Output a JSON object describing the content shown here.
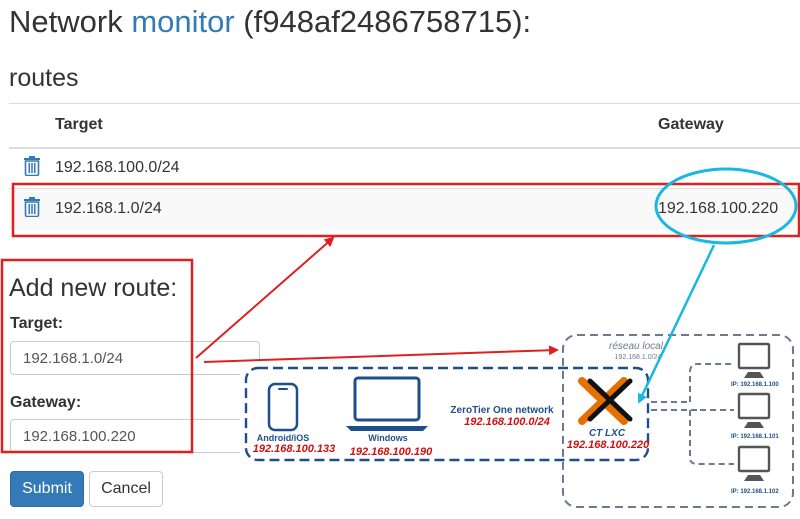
{
  "page": {
    "title_prefix": "Network ",
    "title_link": "monitor",
    "title_suffix": " (f948af2486758715):",
    "section": "routes"
  },
  "routes_table": {
    "headers": [
      "Target",
      "Gateway"
    ],
    "rows": [
      {
        "target": "192.168.100.0/24",
        "gateway": ""
      },
      {
        "target": "192.168.1.0/24",
        "gateway": "192.168.100.220"
      }
    ]
  },
  "form": {
    "heading": "Add new route:",
    "target_label": "Target:",
    "target_value": "192.168.1.0/24",
    "gateway_label": "Gateway:",
    "gateway_value": "192.168.100.220",
    "submit_label": "Submit",
    "cancel_label": "Cancel"
  },
  "diagram": {
    "android_label": "Android/iOS",
    "android_ip": "192.168.100.133",
    "windows_label": "Windows",
    "windows_ip": "192.168.100.190",
    "zerotier_label": "ZeroTier One network",
    "zerotier_net": "192.168.100.0/24",
    "ct_label": "CT  LXC",
    "ct_ip": "192.168.100.220",
    "local_label": "réseau local",
    "local_net": "192.168.1.0/24",
    "host_ips": [
      "IP: 192.168.1.100",
      "IP: 192.168.1.101",
      "IP: 192.168.1.102"
    ]
  },
  "colors": {
    "annotation_red": "#e02020",
    "annotation_cyan": "#1ab8e0",
    "link_blue": "#337ab7",
    "zerotier_blue": "#1f4e8c",
    "proxmox_orange": "#e57000",
    "ip_red": "#d01010"
  },
  "icons": {
    "row_action": "trash-icon",
    "android": "smartphone-icon",
    "windows": "laptop-icon",
    "ct": "proxmox-x-icon",
    "hosts": "desktop-computer-icon"
  }
}
